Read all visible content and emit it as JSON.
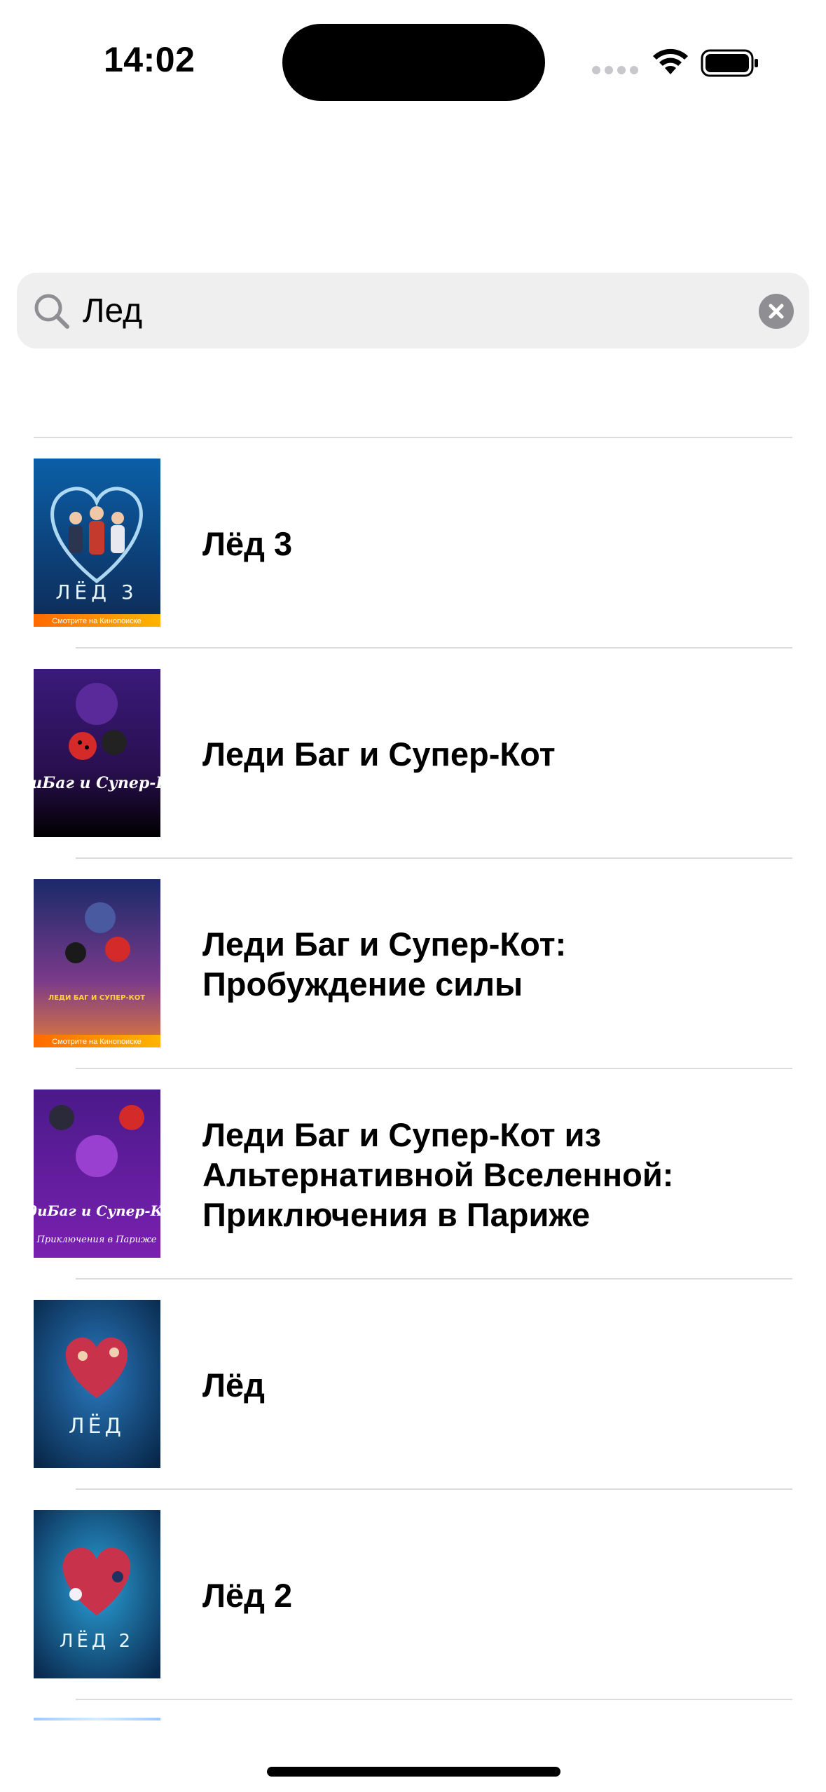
{
  "status_bar": {
    "time": "14:02"
  },
  "search": {
    "query": "Лед",
    "icon": "search-icon",
    "clear_icon": "clear-icon"
  },
  "results": [
    {
      "title": "Лёд 3",
      "poster_text": "ЛЁД 3",
      "poster_caption": "Смотрите на Кинопоиске"
    },
    {
      "title": "Леди Баг и Супер-Кот",
      "poster_text": "ЛедиБаг и Супер-Кот",
      "poster_caption": ""
    },
    {
      "title": "Леди Баг и Супер-Кот:\nПробуждение силы",
      "poster_text": "ЛЕДИ БАГ И СУПЕР-КОТ",
      "poster_caption": "Смотрите на Кинопоиске"
    },
    {
      "title": "Леди Баг и Супер-Кот из\nАльтернативной Вселенной:\nПриключения в Париже",
      "poster_text": "ЛедиБаг и Супер-Кот",
      "poster_caption": "Приключения в Париже"
    },
    {
      "title": "Лёд",
      "poster_text": "ЛЁД",
      "poster_caption": ""
    },
    {
      "title": "Лёд 2",
      "poster_text": "ЛЁД 2",
      "poster_caption": ""
    }
  ],
  "colors": {
    "search_bg": "#efeff0",
    "divider": "#dcdcdf",
    "clear_button": "#8e8e93"
  }
}
